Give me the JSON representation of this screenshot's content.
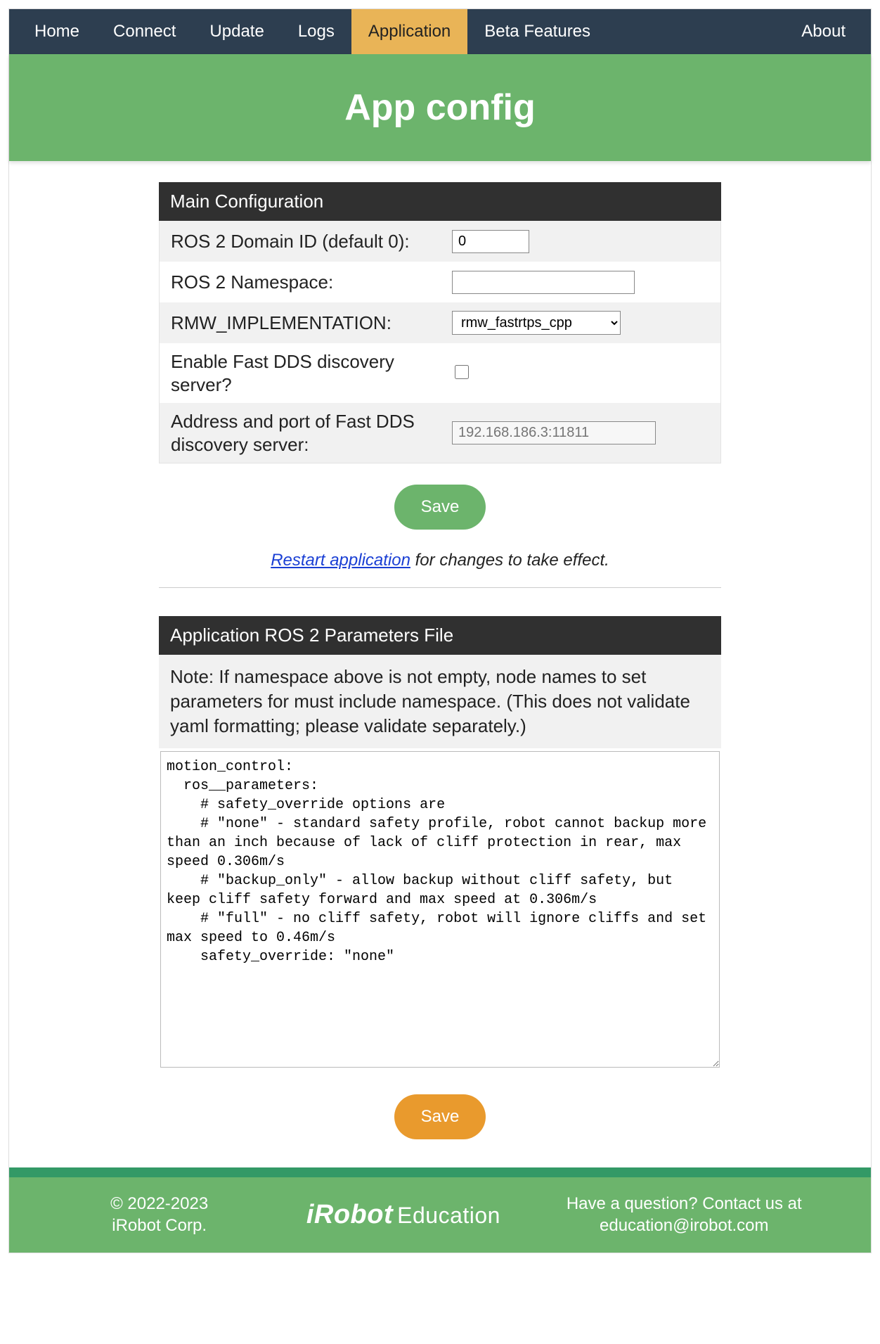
{
  "nav": {
    "items": [
      "Home",
      "Connect",
      "Update",
      "Logs",
      "Application",
      "Beta Features"
    ],
    "active_index": 4,
    "about": "About"
  },
  "hero": {
    "title": "App config"
  },
  "main_config": {
    "header": "Main Configuration",
    "domain_id_label": "ROS 2 Domain ID (default 0):",
    "domain_id_value": "0",
    "namespace_label": "ROS 2 Namespace:",
    "namespace_value": "",
    "rmw_label": "RMW_IMPLEMENTATION:",
    "rmw_options": [
      "rmw_fastrtps_cpp"
    ],
    "rmw_selected": "rmw_fastrtps_cpp",
    "fastdds_enable_label": "Enable Fast DDS discovery server?",
    "fastdds_enable_checked": false,
    "fastdds_addr_label": "Address and port of Fast DDS discovery server:",
    "fastdds_addr_placeholder": "192.168.186.3:11811",
    "save_label": "Save",
    "restart_link": "Restart application",
    "restart_suffix": " for changes to take effect."
  },
  "params_file": {
    "header": "Application ROS 2 Parameters File",
    "note": "Note: If namespace above is not empty, node names to set parameters for must include namespace. (This does not validate yaml formatting; please validate separately.)",
    "yaml": "motion_control:\n  ros__parameters:\n    # safety_override options are\n    # \"none\" - standard safety profile, robot cannot backup more than an inch because of lack of cliff protection in rear, max speed 0.306m/s\n    # \"backup_only\" - allow backup without cliff safety, but keep cliff safety forward and max speed at 0.306m/s\n    # \"full\" - no cliff safety, robot will ignore cliffs and set max speed to 0.46m/s\n    safety_override: \"none\"",
    "save_label": "Save"
  },
  "footer": {
    "copyright_line1": "© 2022-2023",
    "copyright_line2": "iRobot Corp.",
    "brand_main": "iRobot",
    "brand_sub": "Education",
    "question_line1": "Have a question? Contact us at",
    "question_line2": "education@irobot.com"
  }
}
